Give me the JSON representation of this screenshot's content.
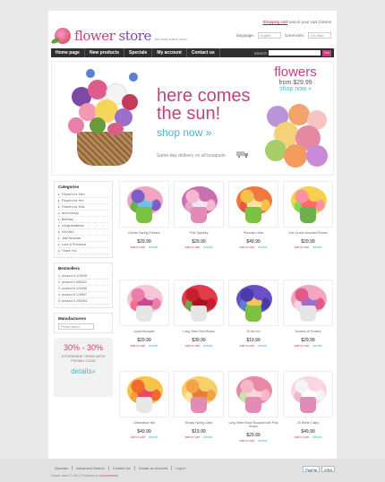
{
  "header": {
    "logo_part1": "flower",
    "logo_part2": " store",
    "tagline": "the best online store",
    "cart_link": "Shopping cart",
    "cart_text": " now in your cart 0 items",
    "language_label": "language:",
    "language_value": "English",
    "currencies_label": "currencies:",
    "currency_value": "US dollar"
  },
  "nav": {
    "items": [
      "Home page",
      "New products",
      "Specials",
      "My account",
      "Contact us"
    ],
    "search_label": "Search",
    "search_button": "Go!"
  },
  "banner": {
    "headline_1": "here comes",
    "headline_2": "the sun!",
    "shop_now": "shop now »",
    "delivery": "Same-day delivery on all bouquets.",
    "right_title": "flowers",
    "right_price": "from $29.99",
    "right_shop": "shop now »"
  },
  "categories": {
    "title": "Categories",
    "items": [
      "Flowers for Men",
      "Flowers for Her",
      "Flowers for Kids",
      "Anniversary",
      "Birthday",
      "Congratulations",
      "Get Well",
      "Just Because",
      "Love & Romance",
      "Thank You"
    ]
  },
  "bestsellers": {
    "title": "Bestsellers",
    "items": [
      "1. product # 123008",
      "2. product # 085332",
      "3. product # 123498",
      "4. product # 124697",
      "5. product # 294354"
    ]
  },
  "manufacturers": {
    "title": "Manufacturers",
    "select_value": "Please select"
  },
  "promo": {
    "line1": "30% - 30%",
    "line2": "STOREWIDE ITEMS WITH PROMO CODE",
    "line3": "details»"
  },
  "products": [
    {
      "name": "Deluxe Spring Flowers",
      "price": "$29.99",
      "add": "add to cart",
      "details": "details"
    },
    {
      "name": "Pink Tapestry",
      "price": "$29.99",
      "add": "add to cart",
      "details": "details"
    },
    {
      "name": "Peruvian Lilies",
      "price": "$49.99",
      "add": "add to cart",
      "details": "details"
    },
    {
      "name": "One Dozen Assorted Roses",
      "price": "$29.99",
      "add": "add to cart",
      "details": "details"
    },
    {
      "name": "Joyful Bouquet",
      "price": "$29.99",
      "add": "add to cart",
      "details": "details"
    },
    {
      "name": "Long Stem Red Roses",
      "price": "$39.99",
      "add": "add to cart",
      "details": "details"
    },
    {
      "name": "20 Iris Inc",
      "price": "$19.99",
      "add": "add to cart",
      "details": "details"
    },
    {
      "name": "Dozens of Flowers",
      "price": "$29.99",
      "add": "add to cart",
      "details": "details"
    },
    {
      "name": "Celebration Mix",
      "price": "$49.99",
      "add": "add to cart",
      "details": "details"
    },
    {
      "name": "Simply Spring Lilies",
      "price": "$19.99",
      "add": "add to cart",
      "details": "details"
    },
    {
      "name": "Long Stem Rose Bouquet with Pink Roses",
      "price": "$29.99",
      "add": "add to cart",
      "details": "details"
    },
    {
      "name": "20 White Tulips",
      "price": "$49.99",
      "add": "add to cart",
      "details": "details"
    }
  ],
  "footer": {
    "links": [
      "Specials",
      "Advanced Search",
      "Contact Us",
      "Create an Account",
      "Log In"
    ],
    "copy": "Flower store © 2010 | Powered by ",
    "copy_brand": "osCommerce",
    "pay1": "PayPal",
    "pay2": "VISA"
  }
}
